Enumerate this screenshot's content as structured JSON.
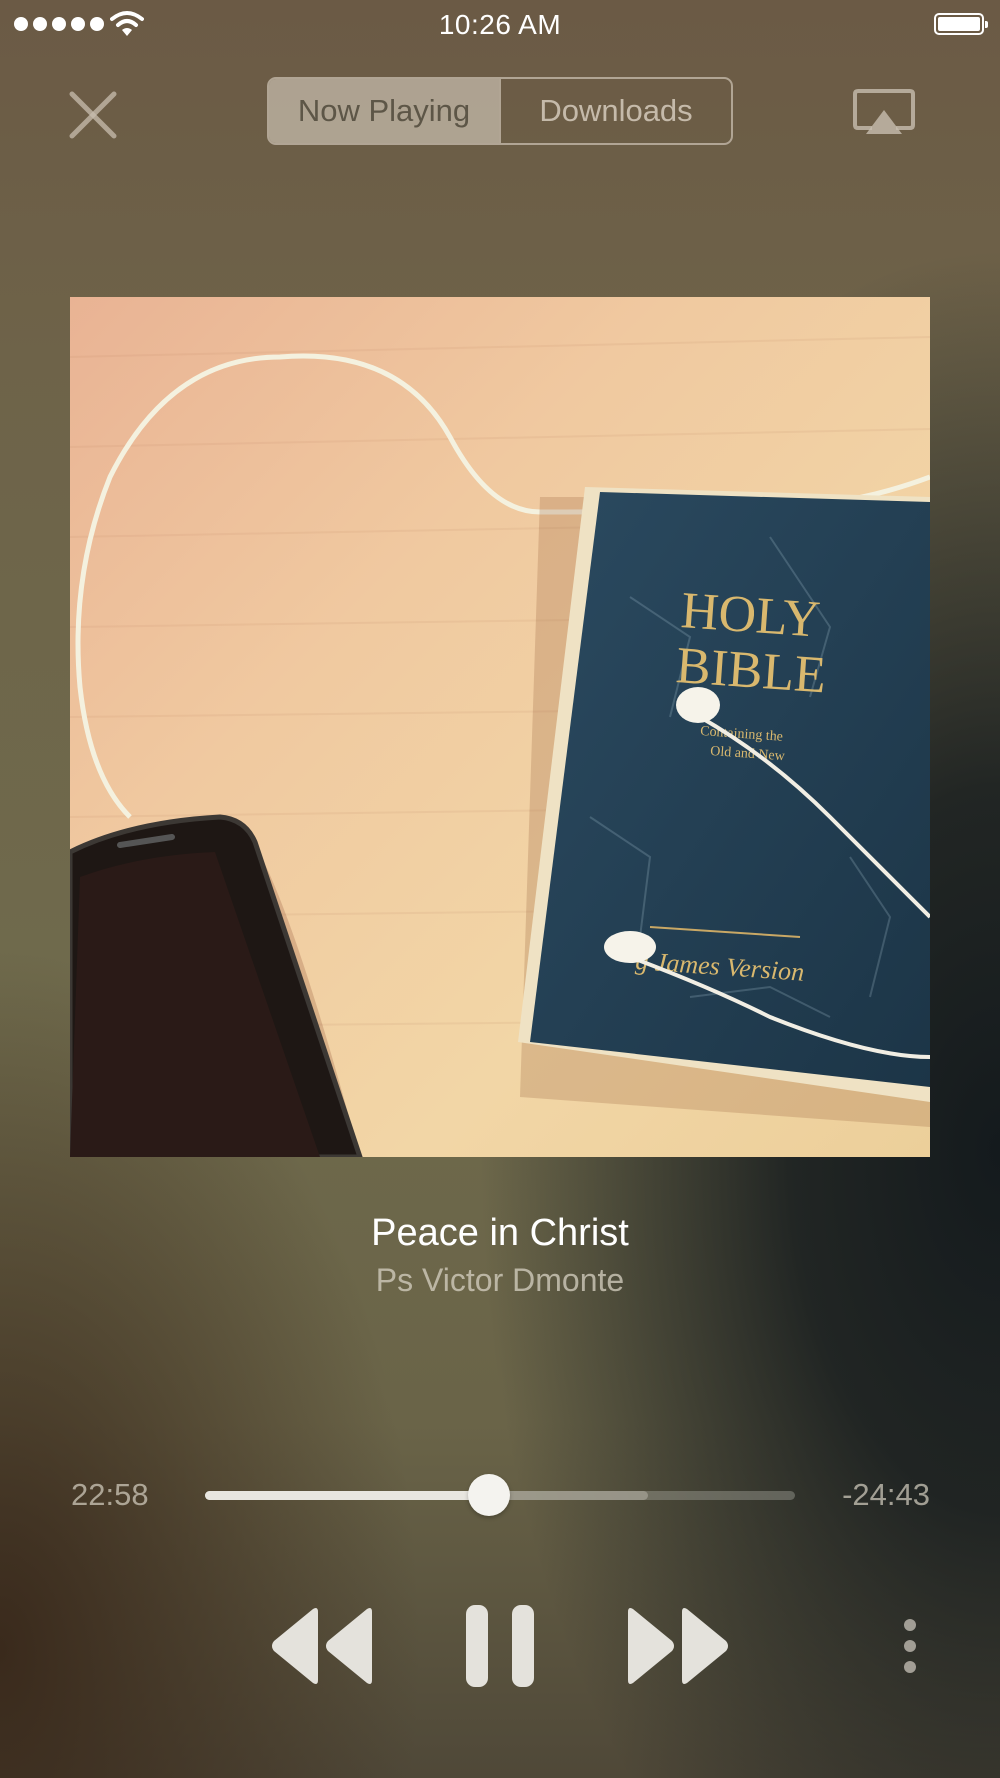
{
  "status_bar": {
    "time": "10:26 AM",
    "signal_icon": "signal-dots-icon",
    "wifi_icon": "wifi-icon",
    "battery_icon": "battery-full-icon"
  },
  "header": {
    "close_icon": "close-icon",
    "tabs": [
      {
        "label": "Now Playing",
        "selected": true
      },
      {
        "label": "Downloads",
        "selected": false
      }
    ],
    "airplay_icon": "airplay-icon"
  },
  "artwork": {
    "cover_text_line1": "HOLY",
    "cover_text_line2": "BIBLE",
    "cover_text_small": "Containing the",
    "cover_text_small2": "Old and New",
    "cover_text_bottom": "g James Version"
  },
  "track": {
    "title": "Peace in Christ",
    "artist": "Ps Victor Dmonte"
  },
  "progress": {
    "elapsed": "22:58",
    "remaining": "-24:43",
    "played_fraction": 0.482,
    "buffered_fraction": 0.75
  },
  "controls": {
    "rewind_icon": "rewind-icon",
    "pause_icon": "pause-icon",
    "forward_icon": "fast-forward-icon",
    "more_icon": "more-vertical-icon"
  },
  "colors": {
    "background": "#6f6a4c",
    "segment_active": "#c8beaf",
    "control": "#e4e2dc"
  }
}
